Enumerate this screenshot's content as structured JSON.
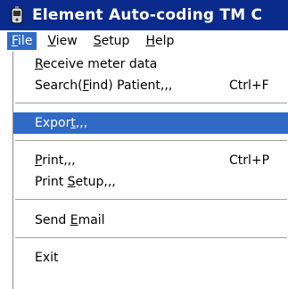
{
  "window": {
    "title": "Element Auto-coding TM C",
    "icon": "ecg-device-icon"
  },
  "menubar": {
    "items": [
      {
        "pre": "",
        "mn": "F",
        "post": "ile"
      },
      {
        "pre": "",
        "mn": "V",
        "post": "iew"
      },
      {
        "pre": "",
        "mn": "S",
        "post": "etup"
      },
      {
        "pre": "",
        "mn": "H",
        "post": "elp"
      }
    ]
  },
  "file_menu": {
    "items": [
      {
        "pre": "",
        "mn": "R",
        "post": "eceive meter data",
        "shortcut": ""
      },
      {
        "pre": "Search(",
        "mn": "F",
        "post": "ind) Patient,,,",
        "shortcut": "Ctrl+F"
      },
      {
        "pre": "Expor",
        "mn": "t",
        "post": ",,,",
        "shortcut": ""
      },
      {
        "pre": "",
        "mn": "P",
        "post": "rint,,,",
        "shortcut": "Ctrl+P"
      },
      {
        "pre": "Print ",
        "mn": "S",
        "post": "etup,,,",
        "shortcut": ""
      },
      {
        "pre": "Send ",
        "mn": "E",
        "post": "mail",
        "shortcut": ""
      },
      {
        "pre": "Exit",
        "mn": "",
        "post": "",
        "shortcut": ""
      }
    ],
    "highlighted_index": 2
  },
  "colors": {
    "titlebar": "#0a2a8c",
    "highlight": "#316ac5"
  }
}
